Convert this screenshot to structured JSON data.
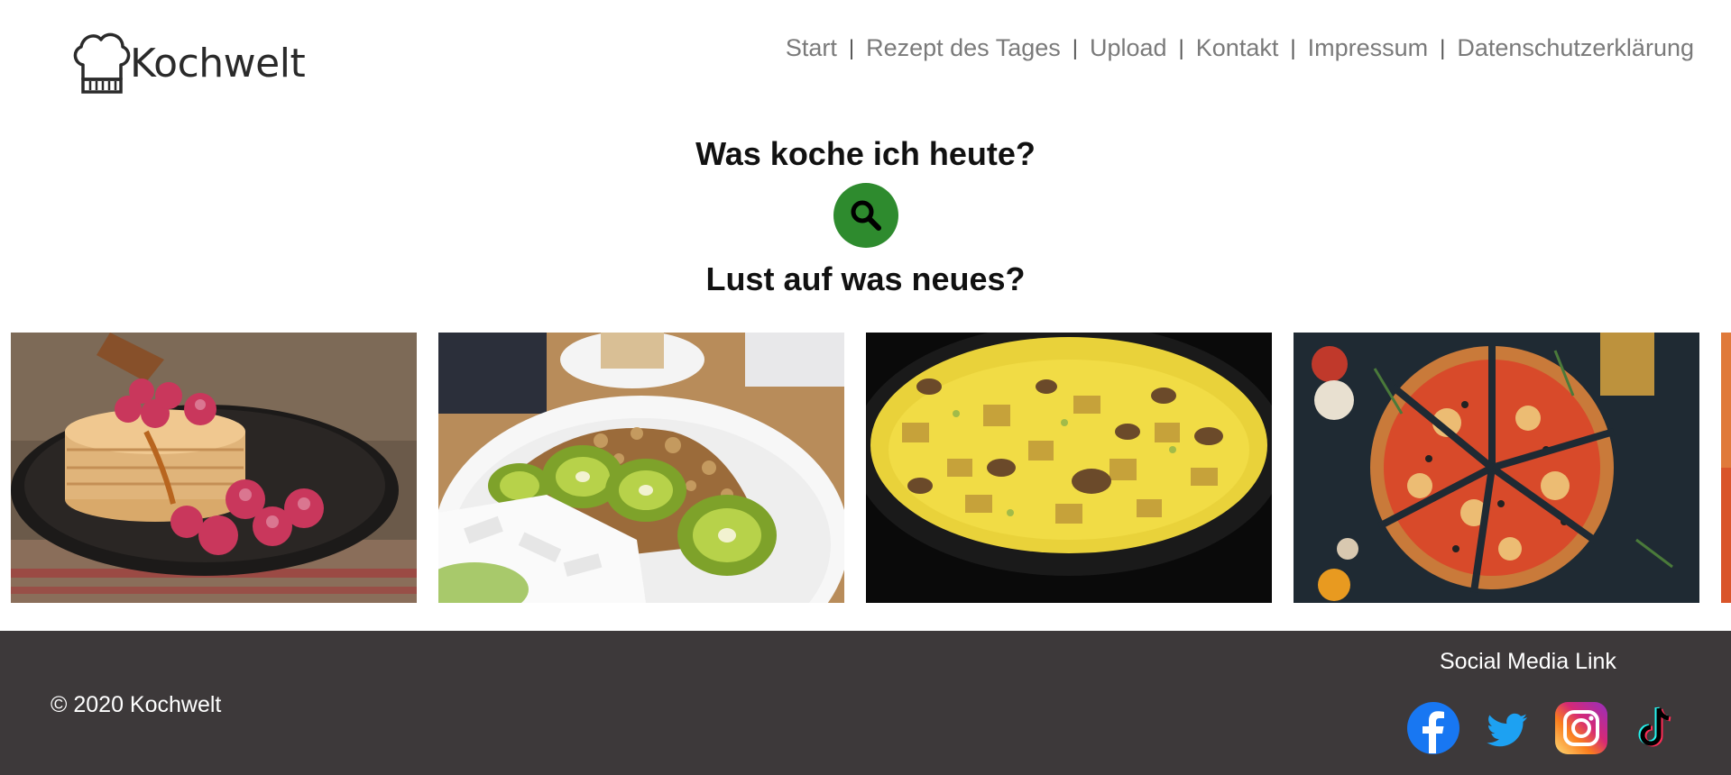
{
  "brand": {
    "name": "Kochwelt",
    "logo_icon": "chef-hat-icon"
  },
  "nav": {
    "items": [
      {
        "label": "Start"
      },
      {
        "label": "Rezept des Tages"
      },
      {
        "label": "Upload"
      },
      {
        "label": "Kontakt"
      },
      {
        "label": "Impressum"
      },
      {
        "label": "Datenschutzerklärung"
      }
    ],
    "separator": "|"
  },
  "main": {
    "question": "Was koche ich heute?",
    "search_icon": "search-icon",
    "search_button_color": "#2e8b2e",
    "teaser": "Lust auf was neues?"
  },
  "carousel": {
    "items": [
      {
        "name": "pancakes-image"
      },
      {
        "name": "kiwi-bowl-image"
      },
      {
        "name": "omelette-image"
      },
      {
        "name": "pizza-image"
      },
      {
        "name": "partial-next-image"
      }
    ]
  },
  "footer": {
    "copyright": "© 2020 Kochwelt",
    "social_title": "Social Media Link",
    "social": [
      {
        "name": "facebook-icon"
      },
      {
        "name": "twitter-icon"
      },
      {
        "name": "instagram-icon"
      },
      {
        "name": "tiktok-icon"
      }
    ],
    "background": "#3d393a"
  }
}
